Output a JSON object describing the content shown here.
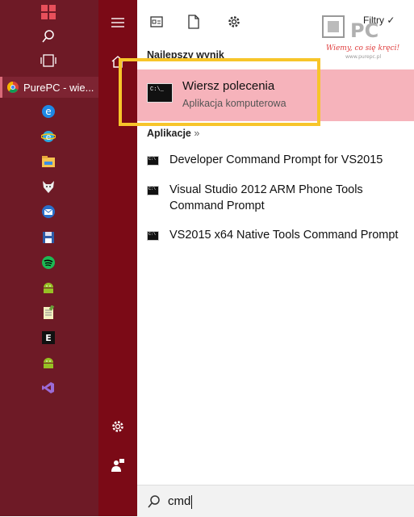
{
  "taskbar": {
    "chrome_label": "PurePC - wie...",
    "icons": [
      "windows-logo-icon",
      "search-icon",
      "task-view-icon",
      "chrome-icon",
      "edge-icon",
      "internet-explorer-icon",
      "file-explorer-icon",
      "wolf-app-icon",
      "thunderbird-icon",
      "save-disk-icon",
      "spotify-icon",
      "android-icon",
      "notepad-icon",
      "terminal-e-icon",
      "android-icon",
      "visual-studio-icon"
    ]
  },
  "toolbar": {
    "filters_label": "Filtry"
  },
  "best_match": {
    "section_title": "Najlepszy wynik",
    "title": "Wiersz polecenia",
    "subtitle": "Aplikacja komputerowa",
    "icon_text": "C:\\_"
  },
  "apps": {
    "section_title": "Aplikacje",
    "section_arrow": "»",
    "items": [
      {
        "label": "Developer Command Prompt for VS2015"
      },
      {
        "label": "Visual Studio 2012 ARM Phone Tools Command Prompt"
      },
      {
        "label": "VS2015 x64 Native Tools Command Prompt"
      }
    ]
  },
  "search": {
    "value": "cmd"
  },
  "logo": {
    "brand": "PC",
    "tagline": "Wiemy, co się kręci!",
    "url": "www.purepc.pl"
  },
  "colors": {
    "taskbar": "#6e1a26",
    "rail": "#7b0a16",
    "selection": "#f6b3bb",
    "highlight": "#f7c52a"
  }
}
